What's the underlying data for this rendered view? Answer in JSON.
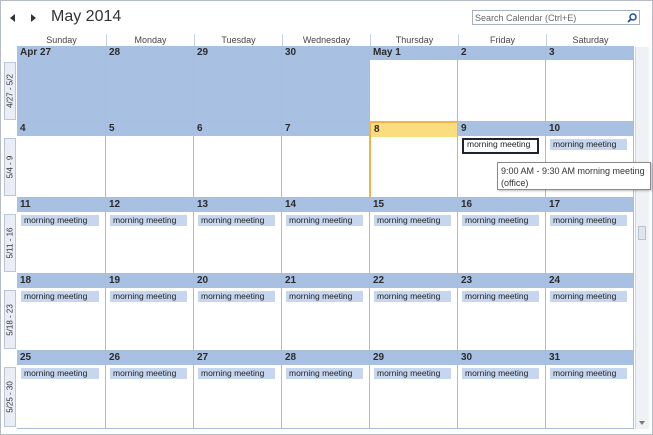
{
  "header": {
    "title": "May 2014",
    "search_placeholder": "Search Calendar (Ctrl+E)"
  },
  "days": [
    "Sunday",
    "Monday",
    "Tuesday",
    "Wednesday",
    "Thursday",
    "Friday",
    "Saturday"
  ],
  "weeks": [
    {
      "label": "4/27 - 5/2",
      "dates": [
        "Apr 27",
        "28",
        "29",
        "30",
        "May 1",
        "2",
        "3"
      ],
      "other_month": [
        true,
        true,
        true,
        true,
        false,
        false,
        false
      ],
      "events": [
        "",
        "",
        "",
        "",
        "",
        "",
        ""
      ]
    },
    {
      "label": "5/4 - 9",
      "dates": [
        "4",
        "5",
        "6",
        "7",
        "8",
        "9",
        "10"
      ],
      "other_month": [
        false,
        false,
        false,
        false,
        false,
        false,
        false
      ],
      "events": [
        "",
        "",
        "",
        "",
        "",
        "morning meeting",
        "morning meeting"
      ]
    },
    {
      "label": "5/11 - 16",
      "dates": [
        "11",
        "12",
        "13",
        "14",
        "15",
        "16",
        "17"
      ],
      "other_month": [
        false,
        false,
        false,
        false,
        false,
        false,
        false
      ],
      "events": [
        "morning meeting",
        "morning meeting",
        "morning meeting",
        "morning meeting",
        "morning meeting",
        "morning meeting",
        "morning meeting"
      ]
    },
    {
      "label": "5/18 - 23",
      "dates": [
        "18",
        "19",
        "20",
        "21",
        "22",
        "23",
        "24"
      ],
      "other_month": [
        false,
        false,
        false,
        false,
        false,
        false,
        false
      ],
      "events": [
        "morning meeting",
        "morning meeting",
        "morning meeting",
        "morning meeting",
        "morning meeting",
        "morning meeting",
        "morning meeting"
      ]
    },
    {
      "label": "5/25 - 30",
      "dates": [
        "25",
        "26",
        "27",
        "28",
        "29",
        "30",
        "31"
      ],
      "other_month": [
        false,
        false,
        false,
        false,
        false,
        false,
        false
      ],
      "events": [
        "morning meeting",
        "morning meeting",
        "morning meeting",
        "morning meeting",
        "morning meeting",
        "morning meeting",
        "morning meeting"
      ]
    }
  ],
  "today": {
    "week": 1,
    "day": 4
  },
  "selected_event": {
    "week": 1,
    "day": 5
  },
  "tooltip": {
    "line1": "9:00 AM - 9:30 AM  morning meeting",
    "line2": "(office)"
  },
  "colors": {
    "other_month": "#a8c0e2",
    "event": "#c5d6ee",
    "today_header": "#fcdd7e",
    "today_border": "#f2b24a"
  }
}
